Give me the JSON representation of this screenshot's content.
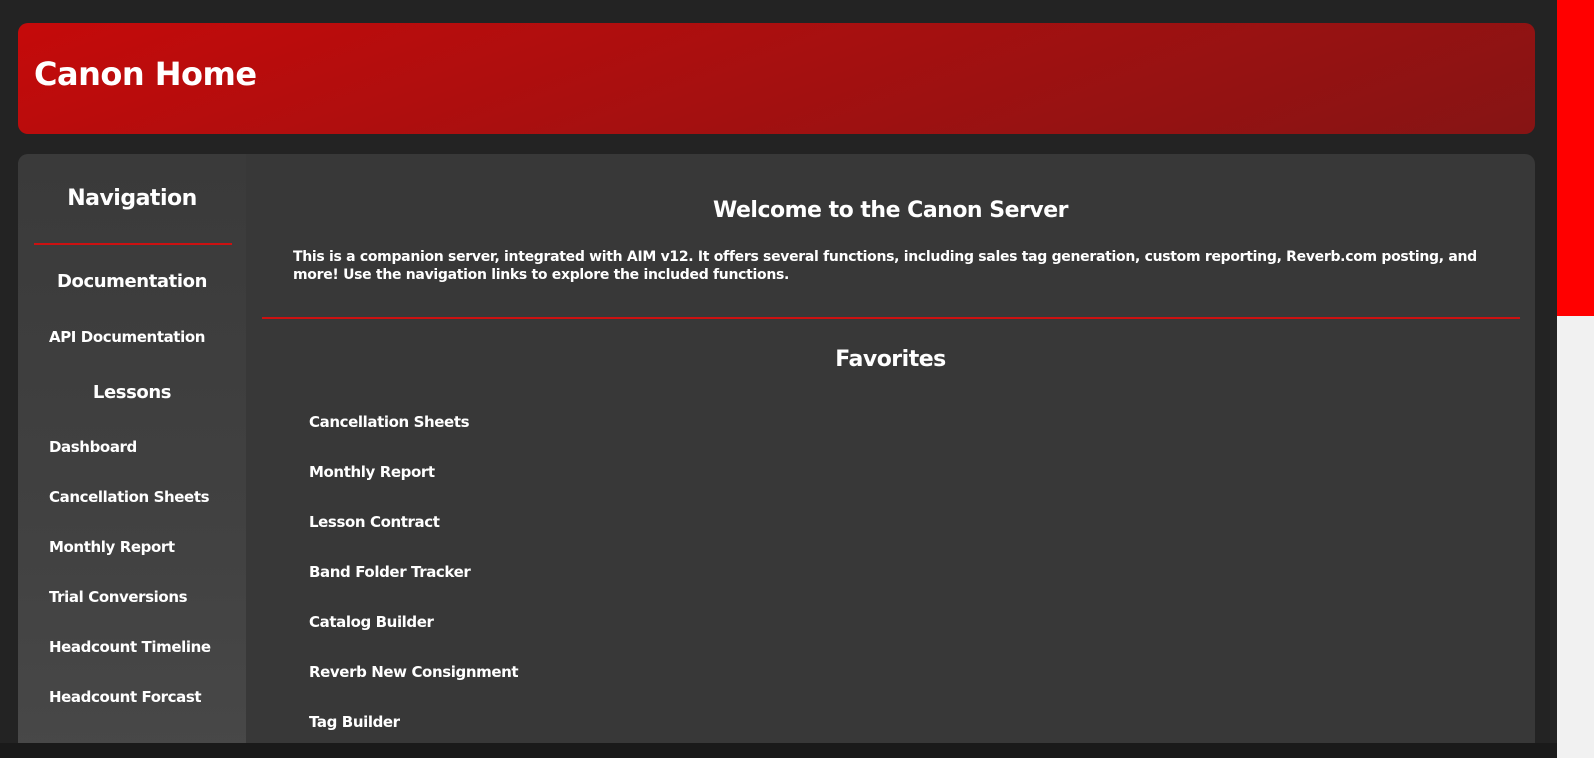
{
  "header": {
    "title": "Canon Home"
  },
  "sidebar": {
    "title": "Navigation",
    "sections": [
      {
        "heading": "Documentation",
        "links": [
          "API Documentation"
        ]
      },
      {
        "heading": "Lessons",
        "links": [
          "Dashboard",
          "Cancellation Sheets",
          "Monthly Report",
          "Trial Conversions",
          "Headcount Timeline",
          "Headcount Forcast"
        ]
      }
    ]
  },
  "main": {
    "welcome_title": "Welcome to the Canon Server",
    "welcome_text": "This is a companion server, integrated with AIM v12. It offers several functions, including sales tag generation, custom reporting, Reverb.com posting, and more! Use the navigation links to explore the included functions.",
    "favorites_title": "Favorites",
    "favorites": [
      "Cancellation Sheets",
      "Monthly Report",
      "Lesson Contract",
      "Band Folder Tracker",
      "Catalog Builder",
      "Reverb New Consignment",
      "Tag Builder"
    ]
  },
  "colors": {
    "header_start": "#c50a0a",
    "header_end": "#861414",
    "accent": "#cc1111",
    "background": "#232323",
    "panel": "#383838",
    "scroll_thumb": "#ff0000"
  }
}
